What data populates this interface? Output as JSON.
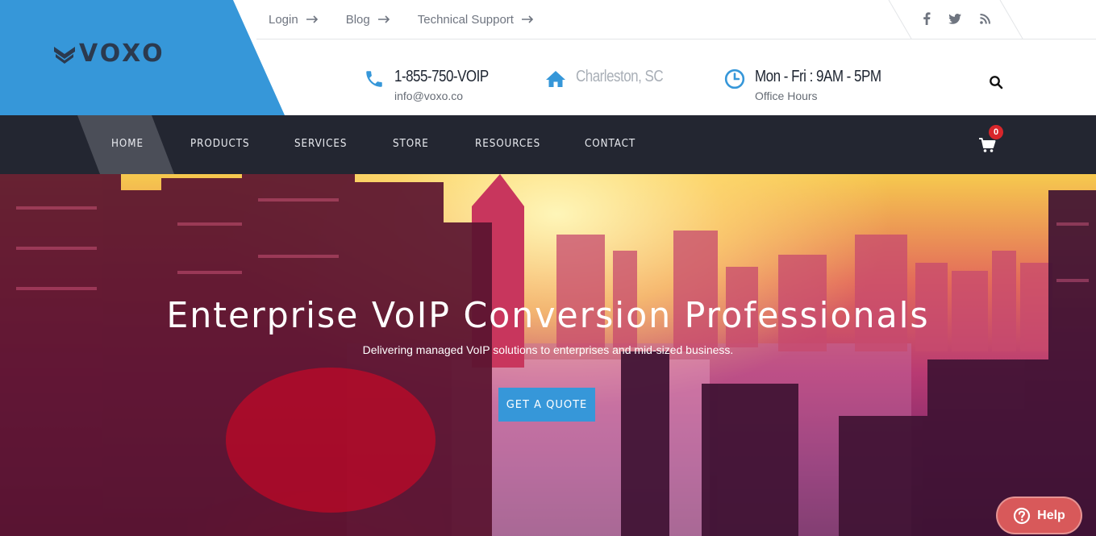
{
  "brand": {
    "name": "VOXO",
    "accent": "#3697d9"
  },
  "top_links": [
    {
      "label": "Login",
      "icon": "arrow-right-icon"
    },
    {
      "label": "Blog",
      "icon": "arrow-right-icon"
    },
    {
      "label": "Technical Support",
      "icon": "arrow-right-icon"
    }
  ],
  "social": [
    "facebook-icon",
    "twitter-icon",
    "rss-icon"
  ],
  "contact": {
    "phone": {
      "title": "1-855-750-VOIP",
      "sub": "info@voxo.co",
      "icon": "phone-icon"
    },
    "location": {
      "title": "Charleston, SC",
      "icon": "home-icon"
    },
    "hours": {
      "title": "Mon - Fri : 9AM - 5PM",
      "sub": "Office Hours",
      "icon": "clock-icon"
    }
  },
  "nav": {
    "items": [
      "HOME",
      "PRODUCTS",
      "SERVICES",
      "STORE",
      "RESOURCES",
      "CONTACT"
    ],
    "active": "HOME",
    "cart_count": "0"
  },
  "hero": {
    "title": "Enterprise VoIP Conversion Professionals",
    "subtitle": "Delivering managed VoIP solutions to enterprises and mid-sized business.",
    "cta": "GET A QUOTE"
  },
  "help": {
    "label": "Help",
    "color": "#d8595a"
  }
}
